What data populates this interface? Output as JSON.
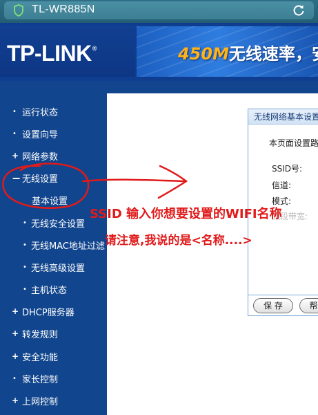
{
  "browser": {
    "url_title": "TL-WR885N"
  },
  "header": {
    "logo": "TP-LINK",
    "banner_number": "450M",
    "banner_text": "无线速率，安"
  },
  "sidebar": {
    "items": [
      {
        "label": "运行状态",
        "marker": "•"
      },
      {
        "label": "设置向导",
        "marker": "•"
      },
      {
        "label": "网络参数",
        "marker": "+"
      },
      {
        "label": "无线设置",
        "marker": "−"
      }
    ],
    "sub_items": [
      {
        "label": "基本设置"
      },
      {
        "label": "无线安全设置"
      },
      {
        "label": "无线MAC地址过滤"
      },
      {
        "label": "无线高级设置"
      },
      {
        "label": "主机状态"
      }
    ],
    "more_items": [
      {
        "label": "DHCP服务器",
        "marker": "+"
      },
      {
        "label": "转发规则",
        "marker": "+"
      },
      {
        "label": "安全功能",
        "marker": "+"
      },
      {
        "label": "家长控制",
        "marker": "•"
      },
      {
        "label": "上网控制",
        "marker": "+"
      }
    ]
  },
  "panel": {
    "title": "无线网络基本设置",
    "description": "本页面设置路",
    "fields": {
      "ssid": "SSID号:",
      "channel": "信道:",
      "mode": "模式:",
      "bandwidth": "频段带宽:"
    },
    "save_label": "保 存",
    "help_label": "帮"
  },
  "annotation": {
    "line1": "SSID 输入你想要设置的WIFI名称",
    "line2": "请注意,我说的是<名称....>",
    "color": "#e11a1a"
  }
}
